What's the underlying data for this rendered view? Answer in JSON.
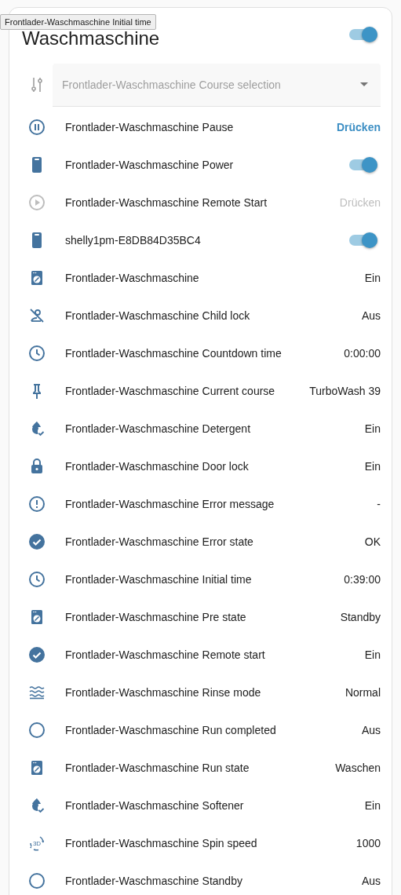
{
  "tooltip": "Frontlader-Waschmaschine Initial time",
  "card": {
    "title": "Waschmaschine",
    "on": true
  },
  "select": {
    "label": "Frontlader-Waschmaschine Course selection",
    "disabled": true
  },
  "rows": [
    {
      "name": "Frontlader-Waschmaschine Pause",
      "kind": "button",
      "action": "Drücken",
      "disabled": false
    },
    {
      "name": "Frontlader-Waschmaschine Power",
      "kind": "toggle",
      "on": true
    },
    {
      "name": "Frontlader-Waschmaschine Remote Start",
      "kind": "button",
      "action": "Drücken",
      "disabled": true
    },
    {
      "name": "shelly1pm-E8DB84D35BC4",
      "kind": "toggle",
      "on": true
    },
    {
      "name": "Frontlader-Waschmaschine",
      "kind": "value",
      "value": "Ein"
    },
    {
      "name": "Frontlader-Waschmaschine Child lock",
      "kind": "value",
      "value": "Aus"
    },
    {
      "name": "Frontlader-Waschmaschine Countdown time",
      "kind": "value",
      "value": "0:00:00"
    },
    {
      "name": "Frontlader-Waschmaschine Current course",
      "kind": "value",
      "value": "TurboWash 39"
    },
    {
      "name": "Frontlader-Waschmaschine Detergent",
      "kind": "value",
      "value": "Ein"
    },
    {
      "name": "Frontlader-Waschmaschine Door lock",
      "kind": "value",
      "value": "Ein"
    },
    {
      "name": "Frontlader-Waschmaschine Error message",
      "kind": "value",
      "value": "-"
    },
    {
      "name": "Frontlader-Waschmaschine Error state",
      "kind": "value",
      "value": "OK"
    },
    {
      "name": "Frontlader-Waschmaschine Initial time",
      "kind": "value",
      "value": "0:39:00"
    },
    {
      "name": "Frontlader-Waschmaschine Pre state",
      "kind": "value",
      "value": "Standby"
    },
    {
      "name": "Frontlader-Waschmaschine Remote start",
      "kind": "value",
      "value": "Ein"
    },
    {
      "name": "Frontlader-Waschmaschine Rinse mode",
      "kind": "value",
      "value": "Normal"
    },
    {
      "name": "Frontlader-Waschmaschine Run completed",
      "kind": "value",
      "value": "Aus"
    },
    {
      "name": "Frontlader-Waschmaschine Run state",
      "kind": "value",
      "value": "Waschen"
    },
    {
      "name": "Frontlader-Waschmaschine Softener",
      "kind": "value",
      "value": "Ein"
    },
    {
      "icon_text": "3D",
      "name": "Frontlader-Waschmaschine Spin speed",
      "kind": "value",
      "value": "1000"
    },
    {
      "name": "Frontlader-Waschmaschine Standby",
      "kind": "value",
      "value": "Aus"
    }
  ]
}
